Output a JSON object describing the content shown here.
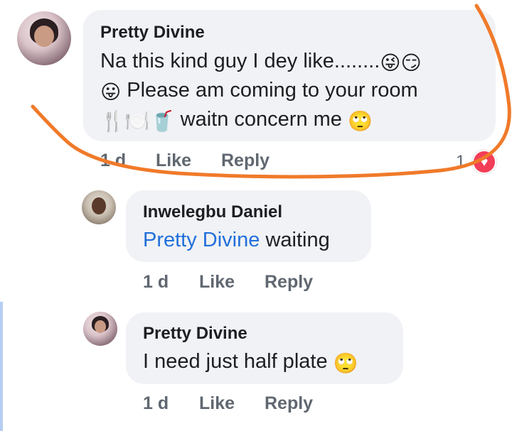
{
  "comments": [
    {
      "author": "Pretty Divine",
      "line1": "Na this kind guy I dey like........",
      "line1_emojis": "😜😏",
      "line2_emoji": "😛",
      "line2": " Please am coming to your room",
      "line3_emojis": "🍴🍽️🥤",
      "line3": " waitn concern me ",
      "line3_end_emoji": "🙄",
      "time": "1 d",
      "like": "Like",
      "reply": "Reply",
      "reaction_count": "1",
      "reaction_icon": "♥"
    },
    {
      "author": "Inwelegbu Daniel",
      "mention": "Pretty Divine",
      "text": " waiting",
      "time": "1 d",
      "like": "Like",
      "reply": "Reply"
    },
    {
      "author": "Pretty Divine",
      "text": "I need just half plate ",
      "emoji": "🙄",
      "time": "1 d",
      "like": "Like",
      "reply": "Reply"
    }
  ],
  "colors": {
    "annotation_stroke": "#f07a2a",
    "mention": "#216fdb",
    "bubble": "#f0f2f5",
    "reaction": "#f33e58"
  }
}
